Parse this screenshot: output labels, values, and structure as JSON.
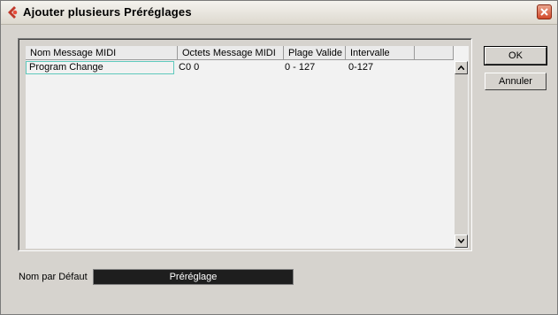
{
  "window": {
    "title": "Ajouter plusieurs Préréglages",
    "close_icon": "close-icon",
    "logo_icon": "app-logo-icon"
  },
  "table": {
    "columns": [
      "Nom Message MIDI",
      "Octets Message MIDI",
      "Plage Valide",
      "Intervalle"
    ],
    "rows": [
      {
        "nom": "Program Change",
        "octets": "C0 0",
        "plage": "0 - 127",
        "intervalle": "0-127"
      }
    ]
  },
  "buttons": {
    "ok": "OK",
    "cancel": "Annuler"
  },
  "default_name": {
    "label": "Nom par Défaut",
    "value": "Préréglage"
  },
  "colors": {
    "accent_selection": "#5fc9bd",
    "field_bg": "#1e1e1e",
    "close_button": "#d2492a"
  }
}
